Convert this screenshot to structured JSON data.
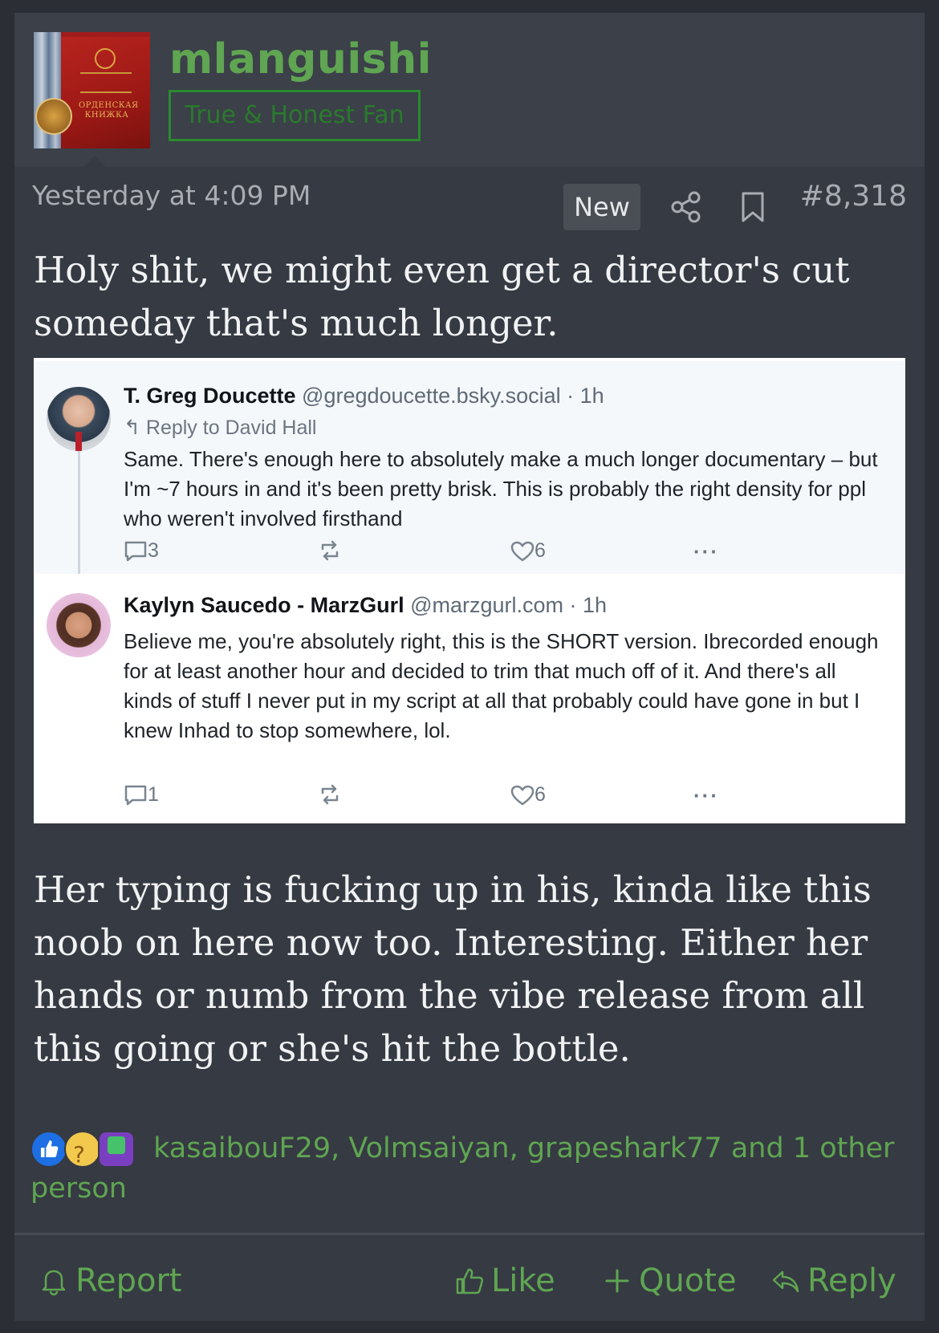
{
  "user": {
    "name": "mlanguishi",
    "title": "True & Honest Fan",
    "avatar_label": "ОРДЕНСКАЯ КНИЖКА"
  },
  "meta": {
    "date": "Yesterday at 4:09 PM",
    "badge": "New",
    "post_number": "#8,318"
  },
  "body": {
    "paragraph_1": "Holy shit, we might even get a director's cut someday that's much longer.",
    "paragraph_2": "Her typing is fucking up in his, kinda like this noob on here now too. Interesting. Either her hands or numb from the vibe release from all this going or she's hit the bottle."
  },
  "embed": {
    "tweets": [
      {
        "display_name": "T. Greg Doucette",
        "handle_time": " @gregdoucette.bsky.social · 1h",
        "reply_to": "↰ Reply to David Hall",
        "text": "Same. There's enough here to absolutely make a much longer documentary – but I'm ~7 hours in and it's been pretty brisk. This is probably the right density for ppl who weren't involved firsthand",
        "replies": "3",
        "likes": "6",
        "more": "···"
      },
      {
        "display_name": "Kaylyn Saucedo - MarzGurl",
        "handle_time": " @marzgurl.com · 1h",
        "text": "Believe me, you're absolutely right, this is the SHORT version. Ibrecorded enough for at least another hour and decided to trim that much off of it. And there's all kinds of stuff I never put in my script at all that probably could have gone in but I knew Inhad to stop somewhere, lol.",
        "replies": "1",
        "likes": "6",
        "more": "···"
      }
    ]
  },
  "reactions": {
    "icons": [
      "like-icon",
      "thinking-icon",
      "puzzle-icon"
    ],
    "text": "kasaibouF29, Volmsaiyan, grapeshark77 and 1 other person"
  },
  "footer": {
    "report": "Report",
    "like": "Like",
    "quote": "Quote",
    "reply": "Reply"
  },
  "colors": {
    "accent_green": "#5fa552",
    "title_border": "#2b8a2f",
    "post_bg": "#363a42",
    "page_bg": "#2b2e35"
  }
}
